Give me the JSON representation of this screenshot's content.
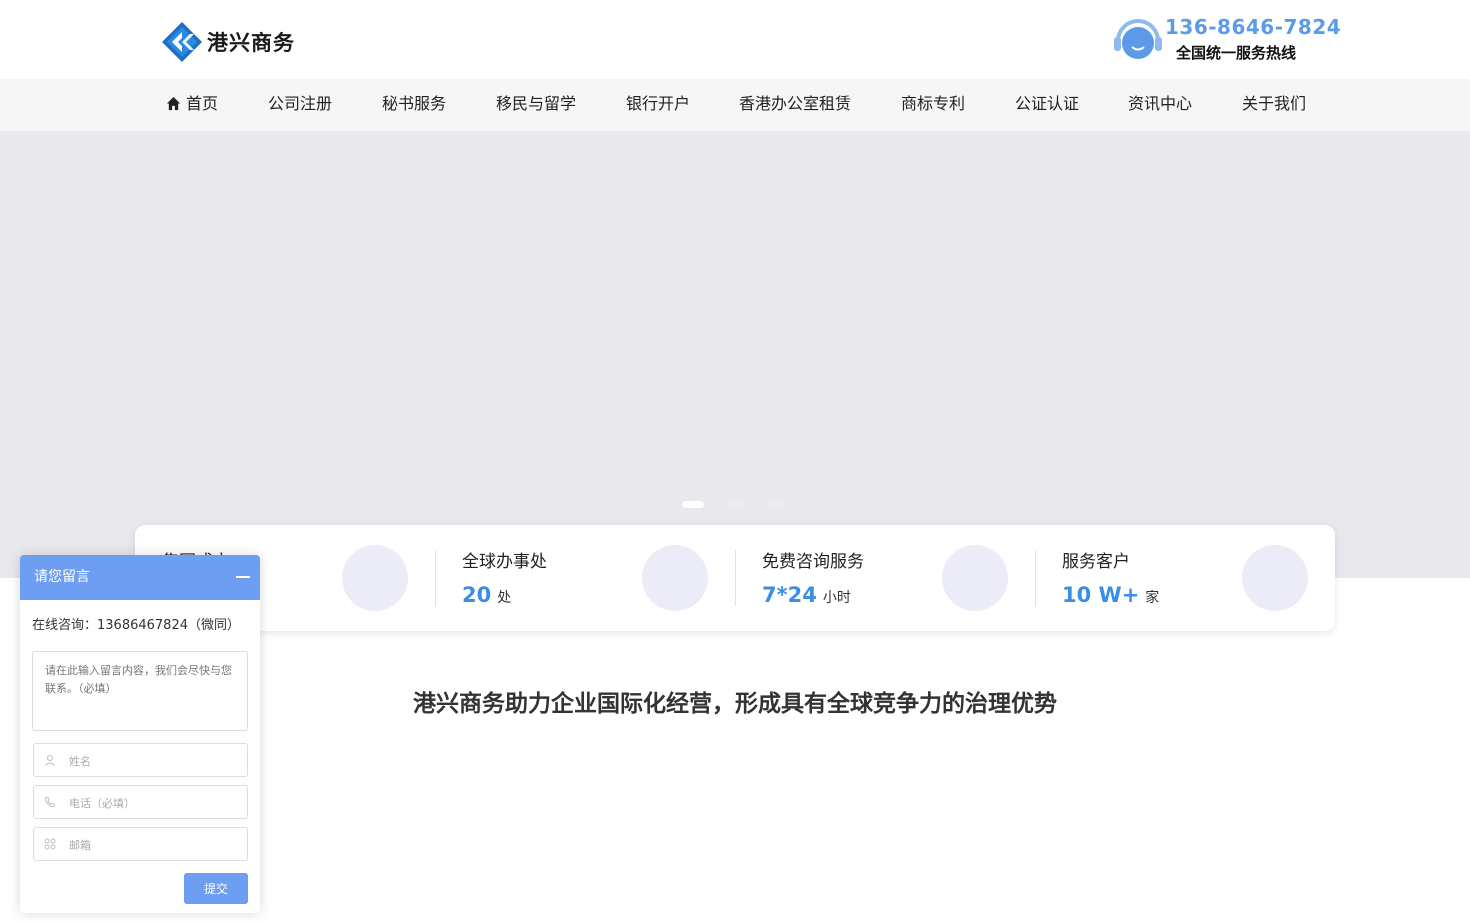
{
  "header": {
    "logo_text": "港兴商务",
    "hotline_number": "136-8646-7824",
    "hotline_caption": "全国统一服务热线"
  },
  "nav": {
    "items": [
      {
        "label": "首页"
      },
      {
        "label": "公司注册"
      },
      {
        "label": "秘书服务"
      },
      {
        "label": "移民与留学"
      },
      {
        "label": "银行开户"
      },
      {
        "label": "香港办公室租赁"
      },
      {
        "label": "商标专利"
      },
      {
        "label": "公证认证"
      },
      {
        "label": "资讯中心"
      },
      {
        "label": "关于我们"
      }
    ]
  },
  "banner": {
    "slide_count": 3,
    "active_slide": 1
  },
  "stats": [
    {
      "title": "集团成立",
      "value": "",
      "unit": ""
    },
    {
      "title": "全球办事处",
      "value": "20",
      "unit": "处"
    },
    {
      "title": "免费咨询服务",
      "value": "7*24",
      "unit": "小时"
    },
    {
      "title": "服务客户",
      "value": "10 W+",
      "unit": "家"
    }
  ],
  "headline": "港兴商务助力企业国际化经营，形成具有全球竞争力的治理优势",
  "message_widget": {
    "title": "请您留言",
    "contact": "在线咨询：13686467824（微同）",
    "textarea_placeholder": "请在此输入留言内容，我们会尽快与您联系。（必填）",
    "name_placeholder": "姓名",
    "phone_placeholder": "电话（必填）",
    "email_placeholder": "邮箱",
    "submit_label": "提交"
  },
  "colors": {
    "accent": "#6d9ef1",
    "stat_number": "#3a8ee6",
    "logo_blue": "#1d6fc4"
  }
}
